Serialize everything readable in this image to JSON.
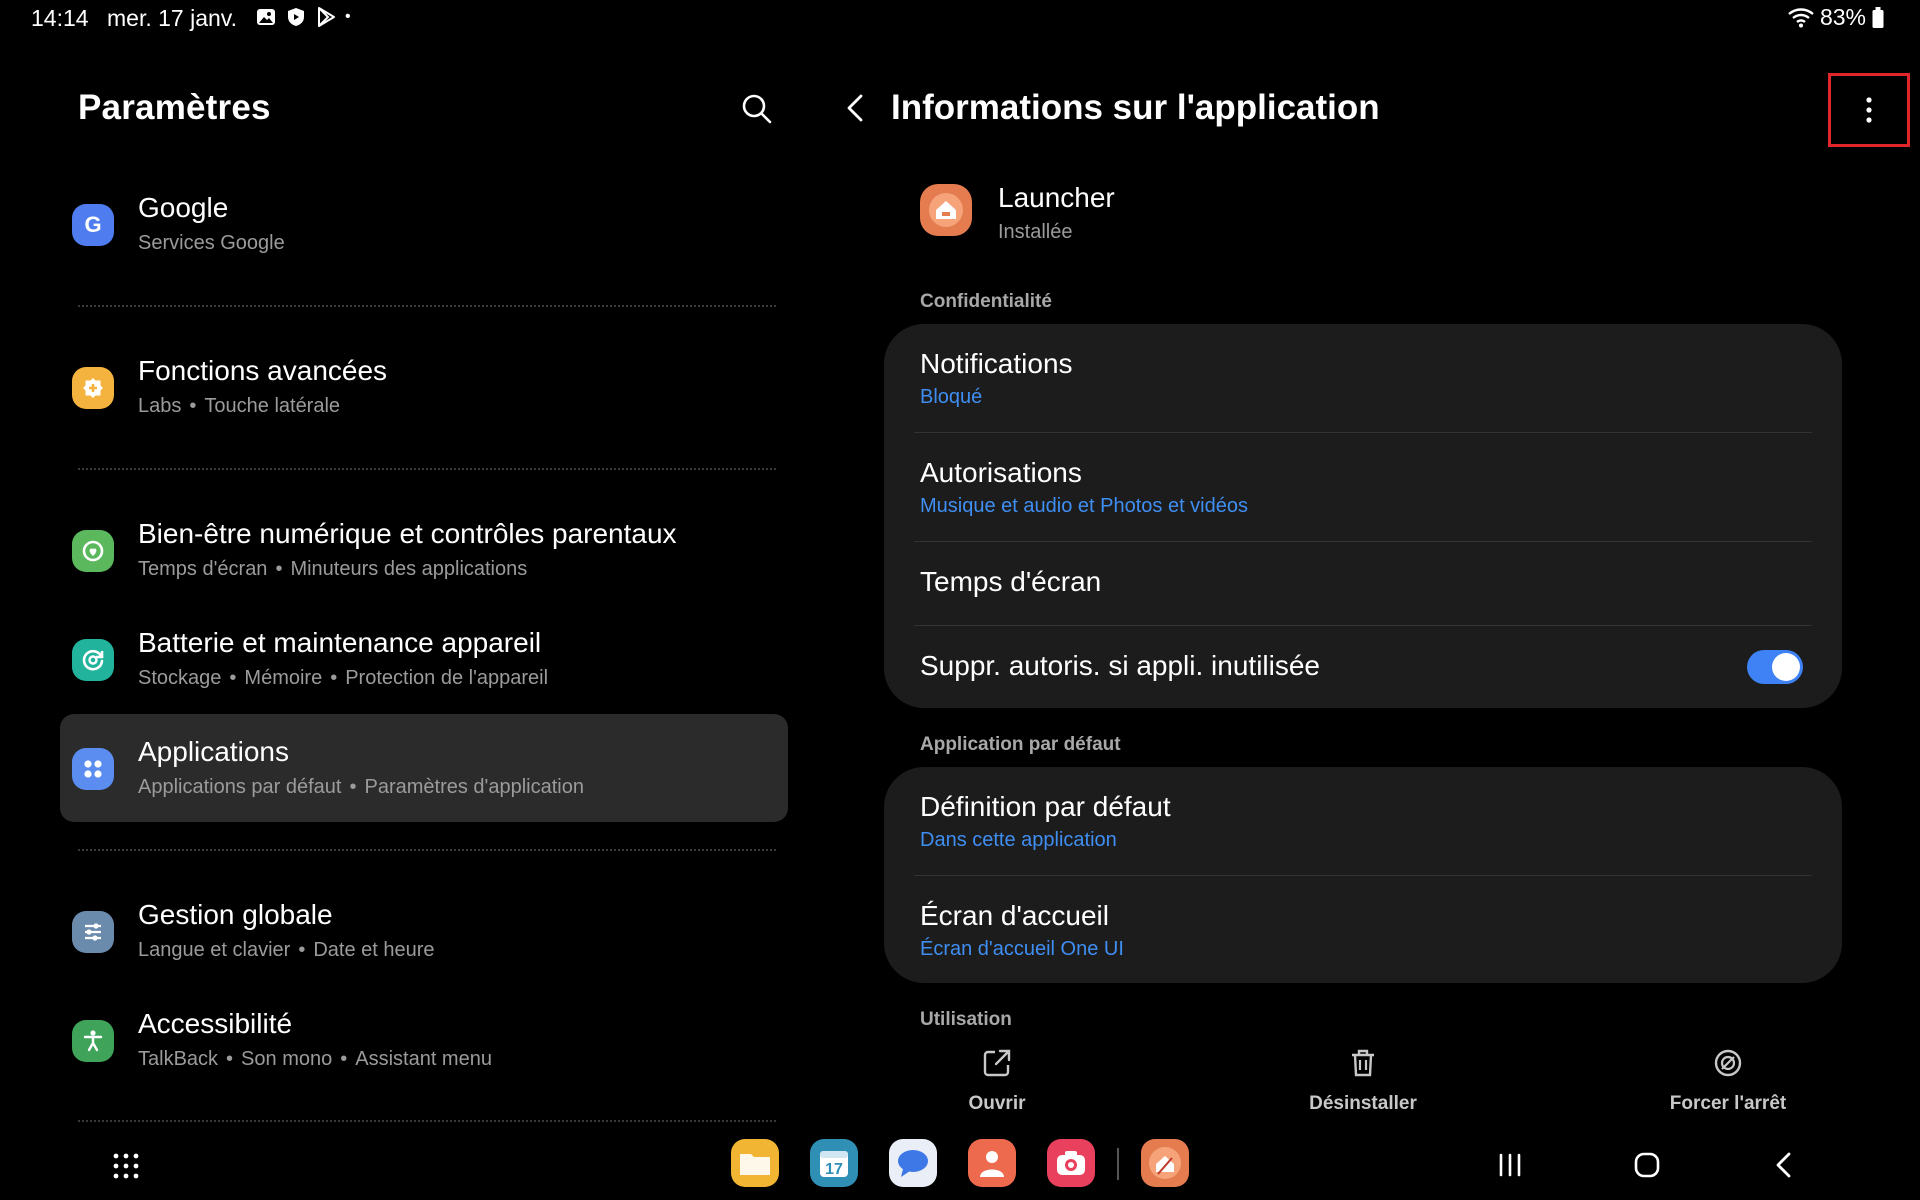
{
  "status_bar": {
    "time": "14:14",
    "date": "mer. 17 janv.",
    "battery": "83%",
    "notification_icons": [
      "gallery-icon",
      "shield-play-icon",
      "play-store-icon"
    ],
    "more_dot": "•"
  },
  "left_panel": {
    "title": "Paramètres",
    "items": [
      {
        "title": "Google",
        "subs": [
          "Services Google"
        ],
        "icon": "google-icon",
        "color": "#4f7df0"
      },
      {
        "title": "Fonctions avancées",
        "subs": [
          "Labs",
          "Touche latérale"
        ],
        "icon": "advanced-features-icon",
        "color": "#f4b23e"
      },
      {
        "title": "Bien-être numérique et contrôles parentaux",
        "subs": [
          "Temps d'écran",
          "Minuteurs des applications"
        ],
        "icon": "digital-wellbeing-icon",
        "color": "#5bb85d"
      },
      {
        "title": "Batterie et maintenance appareil",
        "subs": [
          "Stockage",
          "Mémoire",
          "Protection de l'appareil"
        ],
        "icon": "device-care-icon",
        "color": "#22b39c"
      },
      {
        "title": "Applications",
        "subs": [
          "Applications par défaut",
          "Paramètres d'application"
        ],
        "icon": "apps-icon",
        "color": "#5a8def",
        "selected": true
      },
      {
        "title": "Gestion globale",
        "subs": [
          "Langue et clavier",
          "Date et heure"
        ],
        "icon": "general-management-icon",
        "color": "#6b8bad"
      },
      {
        "title": "Accessibilité",
        "subs": [
          "TalkBack",
          "Son mono",
          "Assistant menu"
        ],
        "icon": "accessibility-icon",
        "color": "#3fa35a"
      }
    ]
  },
  "right_panel": {
    "title": "Informations sur l'application",
    "app": {
      "name": "Launcher",
      "status": "Installée"
    },
    "sections": {
      "privacy": "Confidentialité",
      "default_app": "Application par défaut",
      "usage": "Utilisation"
    },
    "privacy_rows": [
      {
        "title": "Notifications",
        "sub": "Bloqué"
      },
      {
        "title": "Autorisations",
        "sub": "Musique et audio et Photos et vidéos"
      },
      {
        "title": "Temps d'écran"
      },
      {
        "title": "Suppr. autoris. si appli. inutilisée",
        "toggle": true
      }
    ],
    "default_rows": [
      {
        "title": "Définition par défaut",
        "sub": "Dans cette application"
      },
      {
        "title": "Écran d'accueil",
        "sub": "Écran d'accueil One UI"
      }
    ],
    "actions": [
      {
        "label": "Ouvrir",
        "icon": "open-external-icon"
      },
      {
        "label": "Désinstaller",
        "icon": "trash-icon"
      },
      {
        "label": "Forcer l'arrêt",
        "icon": "force-stop-icon"
      }
    ]
  },
  "dock": {
    "apps": [
      {
        "name": "my-files-app",
        "color": "#f2b533"
      },
      {
        "name": "calendar-app",
        "color": "#2f8fb5",
        "label": "17"
      },
      {
        "name": "messages-app",
        "color": "#e9eef7"
      },
      {
        "name": "contacts-app",
        "color": "#ee6a4e"
      },
      {
        "name": "camera-app",
        "color": "#e9405e"
      },
      {
        "name": "launcher-app",
        "color": "#e57c4f"
      }
    ]
  },
  "colors": {
    "accent_blue": "#3f8ef2",
    "card_bg": "#1c1c1c",
    "selected_bg": "#2b2b2b",
    "highlight_red": "#e0262a"
  }
}
